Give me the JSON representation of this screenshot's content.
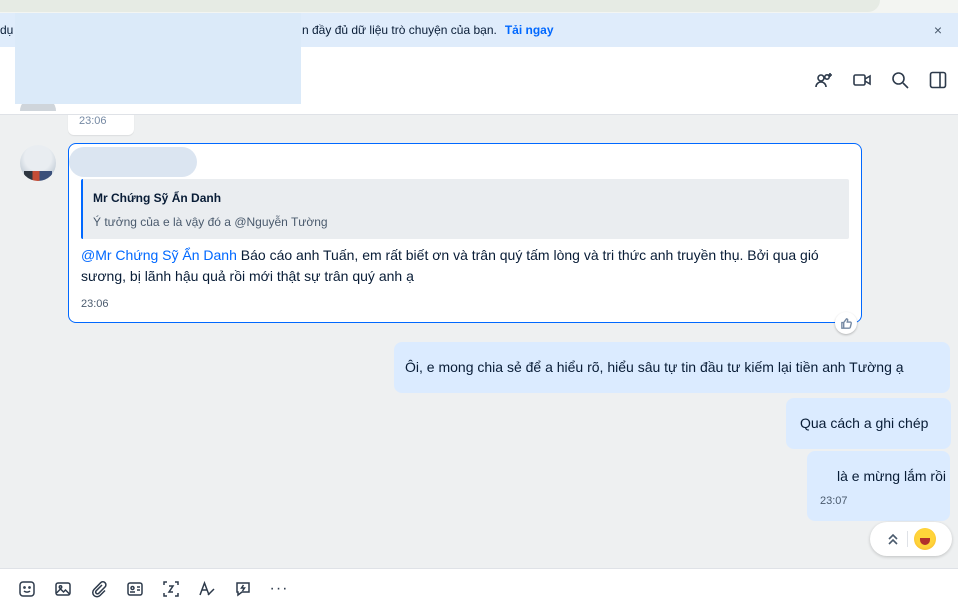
{
  "banner": {
    "left_text": "dụ",
    "text": "n đầy đủ dữ liệu trò chuyện của bạn.",
    "link": "Tải ngay",
    "close_icon": "×"
  },
  "header": {
    "icons": [
      "add-member-icon",
      "video-call-icon",
      "search-icon",
      "sidebar-toggle-icon"
    ]
  },
  "messages": {
    "previous_time": "23:06",
    "incoming": {
      "quote_name": "Mr Chứng Sỹ Ẩn Danh",
      "quote_text": "Ý tưởng của e là vậy đó a @Nguyễn Tường",
      "mention": "@Mr Chứng Sỹ Ẩn Danh",
      "text": " Báo cáo anh Tuấn, em rất biết ơn và trân quý tấm lòng và tri thức anh truyền thụ. Bởi qua gió sương, bị lãnh hậu quả rồi mới thật sự trân quý anh ạ",
      "time": "23:06"
    },
    "outgoing": [
      {
        "text": "Ôi, e mong chia sẻ để a hiểu rõ, hiểu sâu tự tin đầu tư kiếm lại tiền anh Tường ạ"
      },
      {
        "text": "Qua cách a ghi chép"
      },
      {
        "text": "là e mừng lắm rồi",
        "time": "23:07"
      }
    ]
  },
  "toolbar": {
    "icons": [
      "sticker-icon",
      "image-icon",
      "attachment-icon",
      "contact-card-icon",
      "screenshot-icon",
      "format-text-icon",
      "quick-message-icon"
    ],
    "more": "···"
  },
  "colors": {
    "accent": "#0068ff",
    "banner_bg": "#dfecfb",
    "outgoing_bubble": "#dbebff",
    "chat_bg": "#eef0f1"
  }
}
